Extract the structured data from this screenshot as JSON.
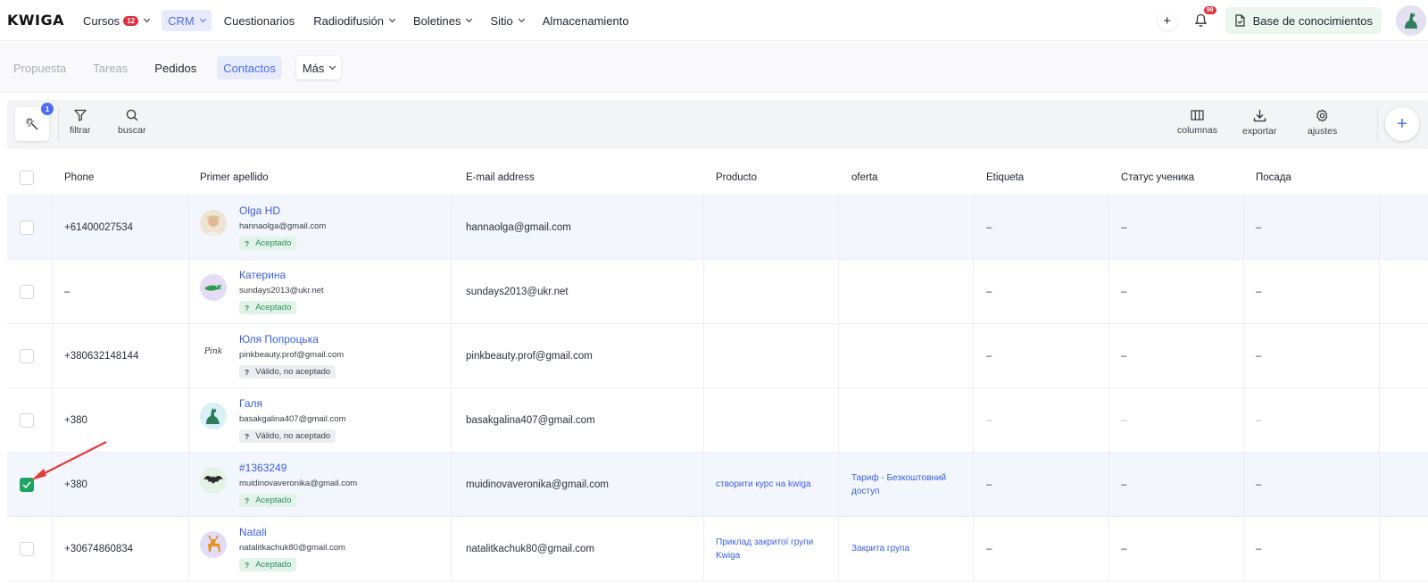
{
  "app": {
    "logo": "KWIGA",
    "nav": [
      {
        "label": "Cursos",
        "badge": "12",
        "chevron": true,
        "active": false
      },
      {
        "label": "CRM",
        "chevron": true,
        "active": true
      },
      {
        "label": "Cuestionarios",
        "chevron": false,
        "active": false
      },
      {
        "label": "Radiodifusión",
        "chevron": true,
        "active": false
      },
      {
        "label": "Boletines",
        "chevron": true,
        "active": false
      },
      {
        "label": "Sitio",
        "chevron": true,
        "active": false
      },
      {
        "label": "Almacenamiento",
        "chevron": false,
        "active": false
      }
    ],
    "add_symbol": "+",
    "notifications_count": "99",
    "knowledge_base": "Base de conocimientos"
  },
  "subnav": {
    "items": [
      {
        "label": "Propuesta",
        "state": "muted"
      },
      {
        "label": "Tareas",
        "state": "muted"
      },
      {
        "label": "Pedidos",
        "state": "normal"
      },
      {
        "label": "Contactos",
        "state": "active"
      },
      {
        "label": "Más",
        "state": "box"
      }
    ]
  },
  "toolbar": {
    "wand_badge": "1",
    "filter": "filtrar",
    "search": "buscar",
    "columns": "columnas",
    "export": "exportar",
    "settings": "ajustes",
    "add_symbol": "+"
  },
  "table": {
    "headers": {
      "phone": "Phone",
      "last_name": "Primer apellido",
      "email": "E-mail address",
      "product": "Producto",
      "offer": "oferta",
      "tag": "Etiqueta",
      "student_status": "Статус ученика",
      "position": "Посада"
    },
    "rows": [
      {
        "checked": false,
        "phone": "+61400027534",
        "name": "Olga HD",
        "email_small": "hannaolga@gmail.com",
        "status": "Aceptado",
        "status_type": "ok",
        "email": "hannaolga@gmail.com",
        "product": "",
        "offer": "",
        "tag": "–",
        "student_status": "–",
        "position": "–",
        "avatar": "photo",
        "dash_light": false
      },
      {
        "checked": false,
        "phone": "–",
        "name": "Катерина",
        "email_small": "sundays2013@ukr.net",
        "status": "Aceptado",
        "status_type": "ok",
        "email": "sundays2013@ukr.net",
        "product": "",
        "offer": "",
        "tag": "–",
        "student_status": "–",
        "position": "–",
        "avatar": "crocodile",
        "dash_light": false
      },
      {
        "checked": false,
        "phone": "+380632148144",
        "name": "Юля Попроцька",
        "email_small": "pinkbeauty.prof@gmail.com",
        "status": "Válido, no aceptado",
        "status_type": "warn",
        "email": "pinkbeauty.prof@gmail.com",
        "product": "",
        "offer": "",
        "tag": "–",
        "student_status": "–",
        "position": "–",
        "avatar": "pink-logo",
        "avatar_text": "Pink",
        "dash_light": false
      },
      {
        "checked": false,
        "phone": "+380",
        "name": "Галя",
        "email_small": "basakgalina407@gmail.com",
        "status": "Válido, no aceptado",
        "status_type": "warn",
        "email": "basakgalina407@gmail.com",
        "product": "",
        "offer": "",
        "tag": "–",
        "student_status": "–",
        "position": "–",
        "avatar": "dinosaur",
        "dash_light": true
      },
      {
        "checked": true,
        "phone": "+380",
        "name": "#1363249",
        "email_small": "muidinovaveronika@gmail.com",
        "status": "Aceptado",
        "status_type": "ok",
        "email": "muidinovaveronika@gmail.com",
        "product": "створити курс на kwiga",
        "offer": "Тариф - Безкоштовний доступ",
        "tag": "–",
        "student_status": "–",
        "position": "–",
        "avatar": "bat",
        "dash_light": false
      },
      {
        "checked": false,
        "phone": "+30674860834",
        "name": "Natali",
        "email_small": "natalitkachuk80@gmail.com",
        "status": "Aceptado",
        "status_type": "ok",
        "email": "natalitkachuk80@gmail.com",
        "product": "Приклад закритої групи Kwiga",
        "offer": "Закрита група",
        "tag": "–",
        "student_status": "–",
        "position": "–",
        "avatar": "deer",
        "dash_light": false
      }
    ]
  },
  "colors": {
    "accent": "#4d6df5",
    "link": "#3b5ee8",
    "checked": "#1fa463",
    "badge_red": "#e0303e",
    "arrow": "#e53935"
  }
}
